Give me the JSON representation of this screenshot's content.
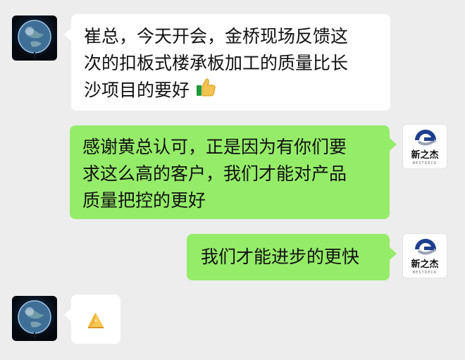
{
  "chat": {
    "messages": [
      {
        "sender": "contact",
        "avatar_icon": "earth-avatar-icon",
        "lines": [
          "崔总，今天开会，金桥现场反馈这",
          "次的扣板式楼承板加工的质量比长",
          "沙项目的要好"
        ],
        "trailing_emoji": "thumbs-up-icon"
      },
      {
        "sender": "self",
        "avatar_icon": "bestdeck-logo-icon",
        "avatar_logo_text": "新之杰",
        "avatar_logo_subtext": "BESTDECK",
        "lines": [
          "感谢黄总认可，正是因为有你们要",
          "求这么高的客户，我们才能对产品",
          "质量把控的更好"
        ]
      },
      {
        "sender": "self",
        "avatar_icon": "bestdeck-logo-icon",
        "avatar_logo_text": "新之杰",
        "avatar_logo_subtext": "BESTDECK",
        "lines": [
          "我们才能进步的更快"
        ]
      },
      {
        "sender": "contact",
        "avatar_icon": "earth-avatar-icon",
        "lines": [],
        "trailing_emoji": "folded-hands-icon"
      }
    ]
  },
  "colors": {
    "background": "#ededed",
    "incoming_bubble": "#ffffff",
    "outgoing_bubble": "#95ec69"
  }
}
